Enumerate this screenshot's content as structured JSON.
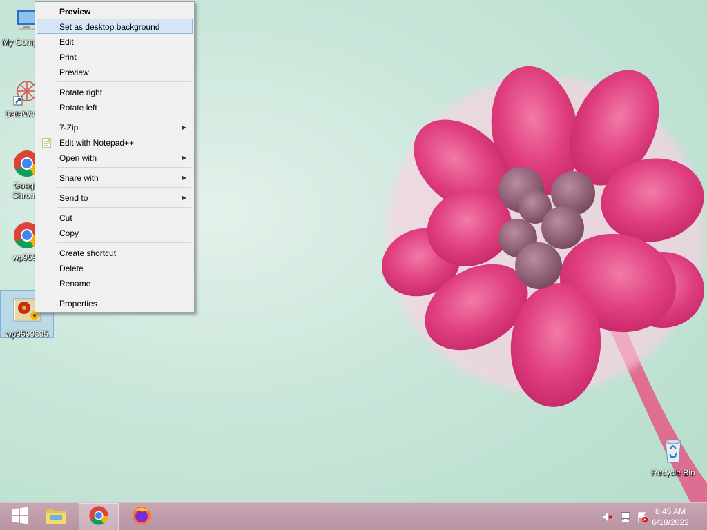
{
  "desktop": {
    "icons": [
      {
        "label": "My Computer"
      },
      {
        "label": "DataWagon"
      },
      {
        "label": "Google Chrome"
      },
      {
        "label": "wp9599"
      },
      {
        "label": "wp9599395"
      },
      {
        "label": "Recycle Bin"
      }
    ]
  },
  "context_menu": {
    "groups": [
      [
        {
          "label": "Preview",
          "bold": true
        },
        {
          "label": "Set as desktop background",
          "highlighted": true
        },
        {
          "label": "Edit"
        },
        {
          "label": "Print"
        },
        {
          "label": "Preview"
        }
      ],
      [
        {
          "label": "Rotate right"
        },
        {
          "label": "Rotate left"
        }
      ],
      [
        {
          "label": "7-Zip",
          "submenu": true
        },
        {
          "label": "Edit with Notepad++",
          "icon": "notepad-plus-plus-icon"
        },
        {
          "label": "Open with",
          "submenu": true
        }
      ],
      [
        {
          "label": "Share with",
          "submenu": true
        }
      ],
      [
        {
          "label": "Send to",
          "submenu": true
        }
      ],
      [
        {
          "label": "Cut"
        },
        {
          "label": "Copy"
        }
      ],
      [
        {
          "label": "Create shortcut"
        },
        {
          "label": "Delete"
        },
        {
          "label": "Rename"
        }
      ],
      [
        {
          "label": "Properties"
        }
      ]
    ]
  },
  "taskbar": {
    "pinned": [
      "start-icon",
      "file-explorer-icon",
      "chrome-icon",
      "firefox-icon"
    ],
    "active": "chrome-icon",
    "tray": [
      "volume-muted-icon",
      "network-icon",
      "action-center-icon"
    ],
    "time": "8:45 AM",
    "date": "6/18/2022"
  },
  "colors": {
    "taskbar": "#b893a4",
    "menu_highlight": "#d5e5f6",
    "flower": "#e03a82"
  }
}
